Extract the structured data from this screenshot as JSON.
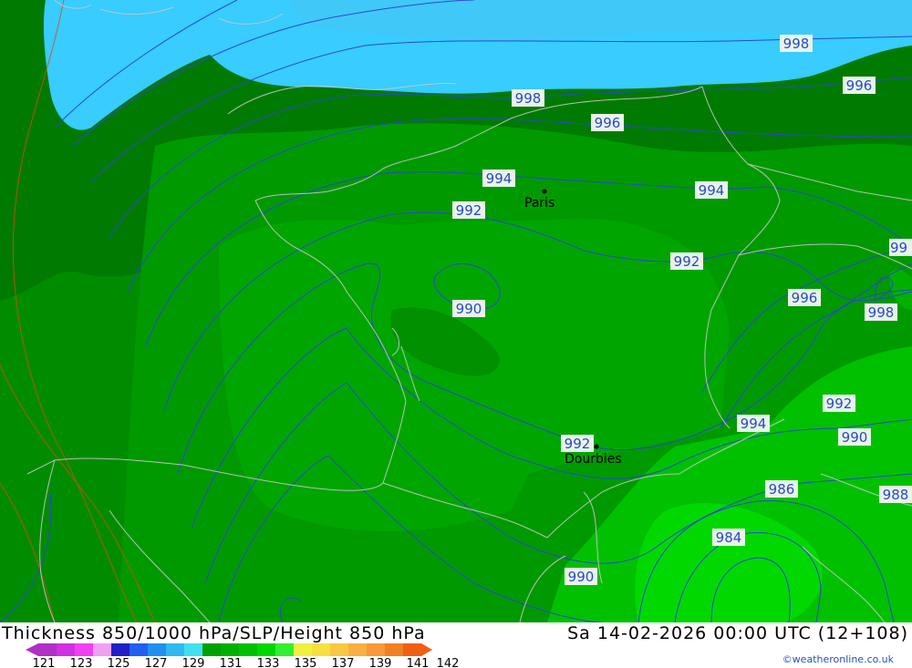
{
  "map": {
    "title": "Thickness 850/1000 hPa/SLP/Height 850 hPa",
    "datetime": "Sa 14-02-2026 00:00 UTC (12+108)",
    "credit": "©weatheronline.co.uk",
    "cities": [
      {
        "id": "paris",
        "name": "Paris"
      },
      {
        "id": "dourbies",
        "name": "Dourbies"
      }
    ],
    "isobar_labels": [
      "998",
      "998",
      "996",
      "996",
      "994",
      "994",
      "992",
      "992",
      "990",
      "996",
      "998",
      "99",
      "992",
      "994",
      "990",
      "992",
      "986",
      "988",
      "984",
      "990"
    ],
    "colors": {
      "ice": "#38ccff",
      "dark_green": "#007a00",
      "mid_green": "#009400",
      "green": "#00a500",
      "bright_green": "#00c800",
      "isobar": "#2b49c9",
      "thickness_line": "#d84a18",
      "border": "#cccccc"
    }
  },
  "legend": {
    "ticks": [
      "121",
      "123",
      "125",
      "127",
      "129",
      "131",
      "133",
      "135",
      "137",
      "139",
      "141",
      "142"
    ],
    "colors": [
      "#b030c8",
      "#d030e0",
      "#f040f0",
      "#f0a0f0",
      "#2020c8",
      "#2060f0",
      "#2090f0",
      "#30b8f0",
      "#40e0f0",
      "#00a000",
      "#00b000",
      "#00c000",
      "#00d800",
      "#30f030",
      "#f0f040",
      "#f8e040",
      "#f8c840",
      "#f8b040",
      "#f89838",
      "#f08020",
      "#f06010"
    ]
  }
}
